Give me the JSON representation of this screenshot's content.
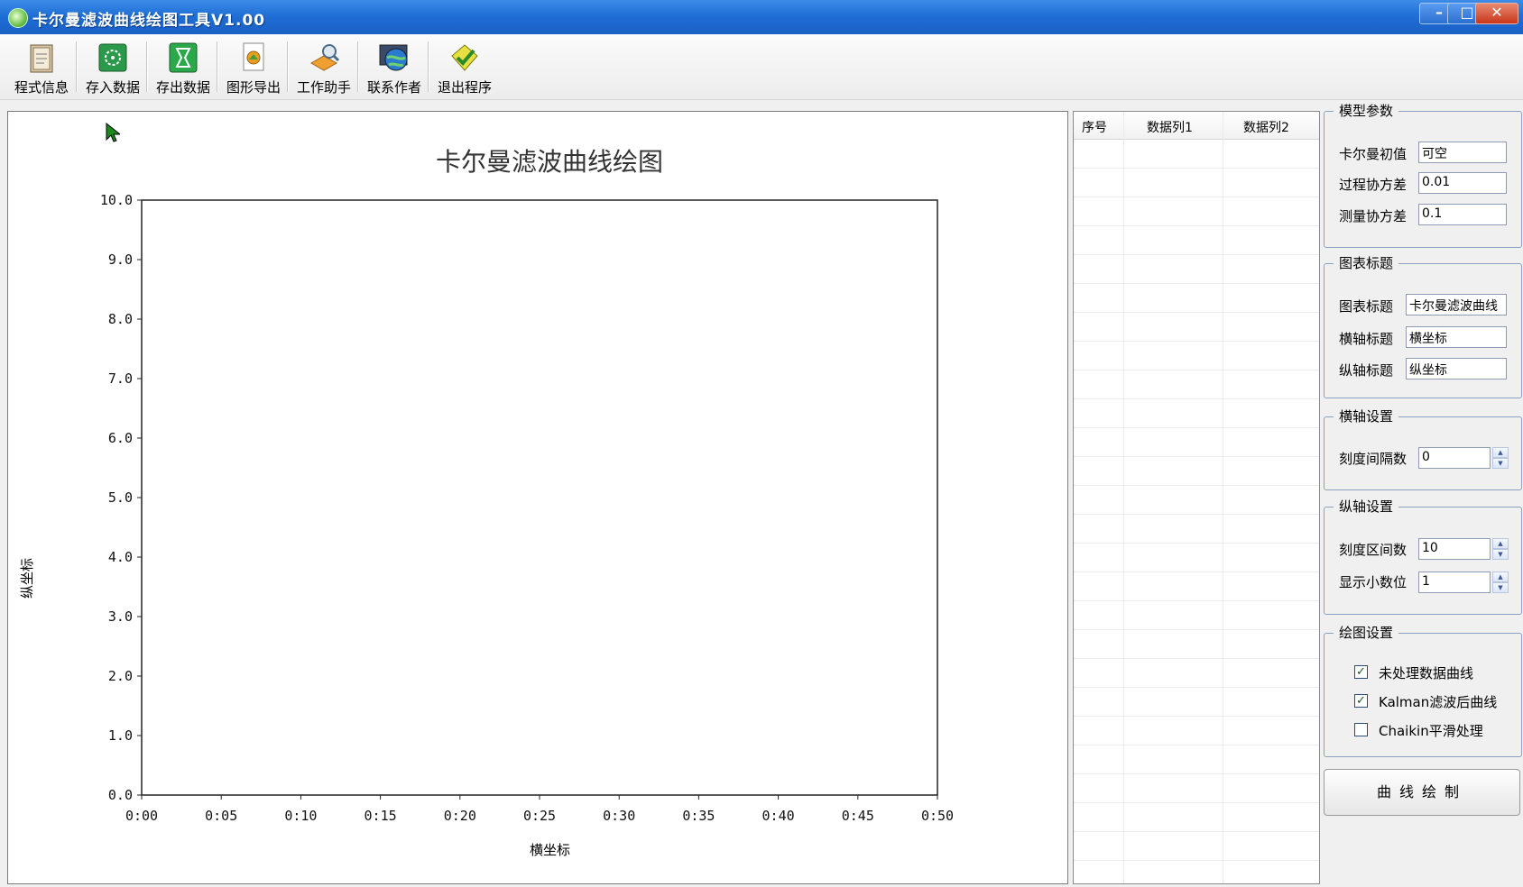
{
  "window": {
    "title": "卡尔曼滤波曲线绘图工具V1.00",
    "min": "–",
    "max": "□",
    "close": "✕"
  },
  "toolbar": [
    {
      "label": "程式信息",
      "icon": "info-book-icon"
    },
    {
      "label": "存入数据",
      "icon": "import-data-icon"
    },
    {
      "label": "存出数据",
      "icon": "export-data-icon"
    },
    {
      "label": "图形导出",
      "icon": "image-export-icon"
    },
    {
      "label": "工作助手",
      "icon": "helper-icon"
    },
    {
      "label": "联系作者",
      "icon": "contact-globe-icon"
    },
    {
      "label": "退出程序",
      "icon": "exit-icon"
    }
  ],
  "chart_data": {
    "type": "line",
    "title": "卡尔曼滤波曲线绘图",
    "xlabel": "横坐标",
    "ylabel": "纵坐标",
    "x_ticks": [
      "0:00",
      "0:05",
      "0:10",
      "0:15",
      "0:20",
      "0:25",
      "0:30",
      "0:35",
      "0:40",
      "0:45",
      "0:50"
    ],
    "y_ticks": [
      "0.0",
      "1.0",
      "2.0",
      "3.0",
      "4.0",
      "5.0",
      "6.0",
      "7.0",
      "8.0",
      "9.0",
      "10.0"
    ],
    "ylim": [
      0,
      10
    ],
    "series": [],
    "grid": false
  },
  "grid": {
    "headers": [
      "序号",
      "数据列1",
      "数据列2"
    ],
    "rows": []
  },
  "model_params": {
    "title": "模型参数",
    "fields": [
      {
        "label": "卡尔曼初值",
        "value": "可空"
      },
      {
        "label": "过程协方差",
        "value": "0.01"
      },
      {
        "label": "测量协方差",
        "value": "0.1"
      }
    ]
  },
  "chart_titles": {
    "title": "图表标题",
    "fields": [
      {
        "label": "图表标题",
        "value": "卡尔曼滤波曲线"
      },
      {
        "label": "横轴标题",
        "value": "横坐标"
      },
      {
        "label": "纵轴标题",
        "value": "纵坐标"
      }
    ]
  },
  "x_axis": {
    "title": "横轴设置",
    "fields": [
      {
        "label": "刻度间隔数",
        "value": "0"
      }
    ]
  },
  "y_axis": {
    "title": "纵轴设置",
    "fields": [
      {
        "label": "刻度区间数",
        "value": "10"
      },
      {
        "label": "显示小数位",
        "value": "1"
      }
    ]
  },
  "plot_settings": {
    "title": "绘图设置",
    "options": [
      {
        "label": "未处理数据曲线",
        "checked": "✓"
      },
      {
        "label": "Kalman滤波后曲线",
        "checked": "✓"
      },
      {
        "label": "Chaikin平滑处理",
        "checked": ""
      }
    ]
  },
  "draw_button": "曲线绘制"
}
